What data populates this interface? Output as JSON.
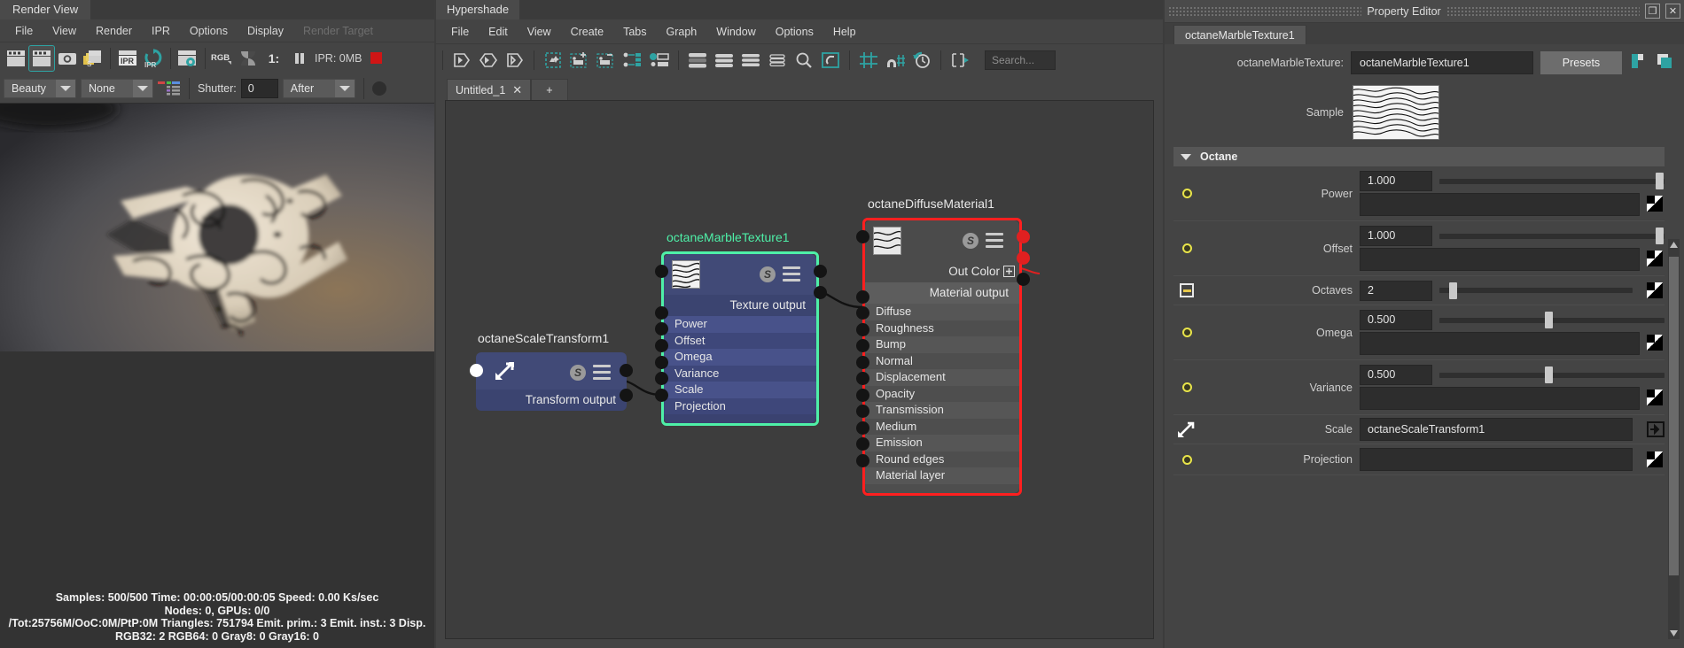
{
  "render_view": {
    "title": "Render View",
    "menu": [
      {
        "label": "File",
        "disabled": false
      },
      {
        "label": "View",
        "disabled": false
      },
      {
        "label": "Render",
        "disabled": false
      },
      {
        "label": "IPR",
        "disabled": false
      },
      {
        "label": "Options",
        "disabled": false
      },
      {
        "label": "Display",
        "disabled": false
      },
      {
        "label": "Render Target",
        "disabled": true
      }
    ],
    "toolbar_icons": [
      "render-current-frame-icon",
      "render-region-icon",
      "snapshot-icon",
      "render-sequence-icon",
      "ipr-render-icon",
      "ipr-refresh-icon",
      "render-settings-icon",
      "rgb-channel-icon",
      "alpha-channel-icon",
      "exposure-icon",
      "pause-icon"
    ],
    "ipr_label": "IPR: 0MB",
    "ratio_label": "1:",
    "options": {
      "pass_value": "Beauty",
      "camera_value": "None",
      "layers_icon": "render-layers-icon",
      "shutter_label": "Shutter:",
      "shutter_value": "0",
      "shutter_mode": "After"
    },
    "status_lines": [
      "Samples: 500/500 Time: 00:00:05/00:00:05 Speed: 0.00 Ks/sec",
      "Nodes: 0, GPUs: 0/0",
      "/Tot:25756M/OoC:0M/PtP:0M Triangles: 751794 Emit. prim.: 3 Emit. inst.: 3 Disp.",
      "RGB32: 2 RGB64: 0 Gray8: 0 Gray16: 0"
    ]
  },
  "hypershade": {
    "title": "Hypershade",
    "menu": [
      "File",
      "Edit",
      "View",
      "Create",
      "Tabs",
      "Graph",
      "Window",
      "Options",
      "Help"
    ],
    "toolbar_icons": [
      "input-connections-icon",
      "input-output-connections-icon",
      "output-connections-icon",
      "clear-graph-icon",
      "add-selected-icon",
      "remove-selected-icon",
      "rearrange-graph-icon",
      "show-connections-icon",
      "layout-horizontal-icon",
      "layout-stacked-icon",
      "layout-list-icon",
      "layout-compact-icon",
      "zoom-icon",
      "frame-all-icon",
      "grid-icon",
      "snap-to-grid-icon",
      "reset-view-icon",
      "show-outputs-icon"
    ],
    "search_placeholder": "Search...",
    "tabs": [
      {
        "label": "Untitled_1",
        "close_icon": "close-icon"
      }
    ],
    "add_tab_label": "+",
    "nodes": [
      {
        "id": "scale-transform",
        "title": "octaneScaleTransform1",
        "output_label": "Transform output",
        "type_icon": "transform-icon",
        "rows": [],
        "selected": false,
        "accent": "none"
      },
      {
        "id": "marble-texture",
        "title": "octaneMarbleTexture1",
        "output_label": "Texture output",
        "rows": [
          "Power",
          "Offset",
          "Omega",
          "Variance",
          "Scale",
          "Projection"
        ],
        "selected": true,
        "accent": "#4ef0a8"
      },
      {
        "id": "diffuse-material",
        "title": "octaneDiffuseMaterial1",
        "out_color_label": "Out Color",
        "output_label": "Material output",
        "rows": [
          "Diffuse",
          "Roughness",
          "Bump",
          "Normal",
          "Displacement",
          "Opacity",
          "Transmission",
          "Medium",
          "Emission",
          "Round edges",
          "Material layer"
        ],
        "selected": true,
        "accent": "#ff1f1f"
      }
    ]
  },
  "property_editor": {
    "title": "Property Editor",
    "restore_icon": "restore-window-icon",
    "close_icon": "close-icon",
    "tab_label": "octaneMarbleTexture1",
    "name_label": "octaneMarbleTexture:",
    "name_value": "octaneMarbleTexture1",
    "presets_label": "Presets",
    "icon_buttons": [
      "copy-tab-icon",
      "new-tab-icon"
    ],
    "sample_label": "Sample",
    "section_label": "Octane",
    "section_collapse_icon": "chevron-down-icon",
    "rows": [
      {
        "label": "Power",
        "value": "1.000",
        "slider": 0.97,
        "icon": "yellow-dot-icon",
        "wide": true,
        "has_checker": true
      },
      {
        "label": "Offset",
        "value": "1.000",
        "slider": 0.97,
        "icon": "yellow-dot-icon",
        "wide": true,
        "has_checker": true
      },
      {
        "label": "Octaves",
        "value": "2",
        "slider": 0.06,
        "icon": "minus-box-icon",
        "wide": false,
        "has_checker": true
      },
      {
        "label": "Omega",
        "value": "0.500",
        "slider": 0.48,
        "icon": "yellow-dot-icon",
        "wide": true,
        "has_checker": true
      },
      {
        "label": "Variance",
        "value": "0.500",
        "slider": 0.48,
        "icon": "yellow-dot-icon",
        "wide": true,
        "has_checker": true
      },
      {
        "label": "Scale",
        "value": "octaneScaleTransform1",
        "icon": "transform-icon",
        "wide": false,
        "linked": true,
        "has_goto": true
      },
      {
        "label": "Projection",
        "value": "",
        "icon": "yellow-dot-icon",
        "wide": false,
        "has_checker": true
      }
    ]
  }
}
